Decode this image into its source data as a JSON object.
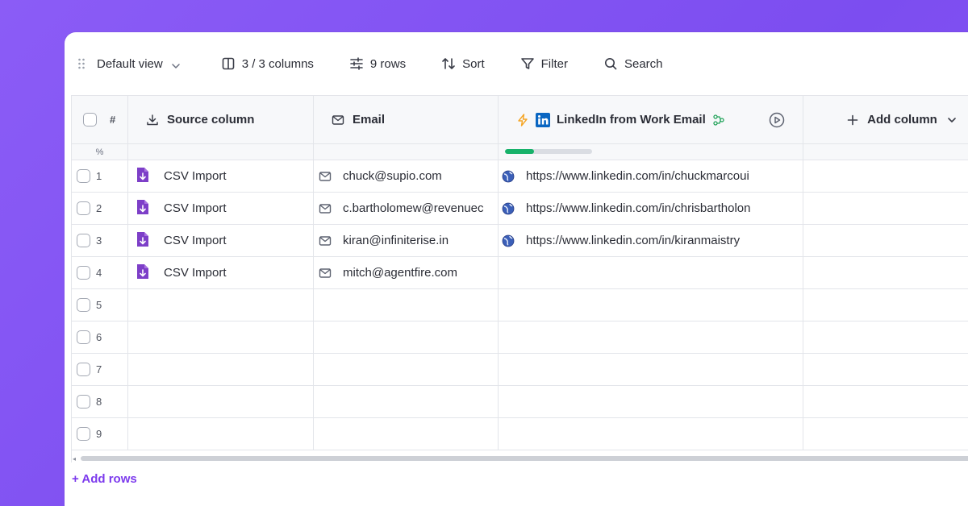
{
  "toolbar": {
    "view_label": "Default view",
    "columns_label": "3 / 3 columns",
    "rows_label": "9 rows",
    "sort_label": "Sort",
    "filter_label": "Filter",
    "search_label": "Search"
  },
  "table": {
    "index_header": "#",
    "percent_label": "%",
    "columns": {
      "source": "Source column",
      "email": "Email",
      "linkedin": "LinkedIn from Work Email",
      "add": "Add column"
    },
    "progress_fraction": 0.33,
    "rows": [
      {
        "num": "1",
        "source": "CSV Import",
        "email": "chuck@supio.com",
        "linkedin": "https://www.linkedin.com/in/chuckmarcoui"
      },
      {
        "num": "2",
        "source": "CSV Import",
        "email": "c.bartholomew@revenuec",
        "linkedin": "https://www.linkedin.com/in/chrisbartholon"
      },
      {
        "num": "3",
        "source": "CSV Import",
        "email": "kiran@infiniterise.in",
        "linkedin": "https://www.linkedin.com/in/kiranmaistry"
      },
      {
        "num": "4",
        "source": "CSV Import",
        "email": "mitch@agentfire.com",
        "linkedin": ""
      },
      {
        "num": "5",
        "source": "",
        "email": "",
        "linkedin": ""
      },
      {
        "num": "6",
        "source": "",
        "email": "",
        "linkedin": ""
      },
      {
        "num": "7",
        "source": "",
        "email": "",
        "linkedin": ""
      },
      {
        "num": "8",
        "source": "",
        "email": "",
        "linkedin": ""
      },
      {
        "num": "9",
        "source": "",
        "email": "",
        "linkedin": ""
      }
    ]
  },
  "footer": {
    "add_rows_label": "+ Add rows"
  },
  "colors": {
    "background": "#8b5cf6",
    "accent": "#7c3aed",
    "csv_icon": "#7d3fc8",
    "linkedin_blue": "#0a66c2",
    "progress_green": "#17b26a",
    "lightning": "#f5a524"
  },
  "icons": {
    "drag": "drag-handle-icon",
    "view_chevron": "chevron-down-icon",
    "columns": "columns-icon",
    "rows": "sliders-icon",
    "sort": "sort-arrows-icon",
    "filter": "filter-funnel-icon",
    "search": "search-icon",
    "source": "download-icon",
    "email": "mail-icon",
    "linkedin": "linkedin-icon",
    "enrich": "lightning-icon",
    "waterfall": "waterfall-icon",
    "run": "play-circle-icon",
    "add": "plus-icon",
    "csv": "csv-import-icon",
    "globe": "globe-icon"
  }
}
